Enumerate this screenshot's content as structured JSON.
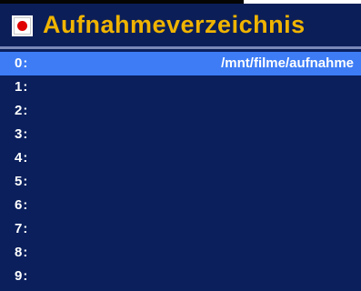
{
  "window": {
    "title": "Aufnahmeverzeichnis",
    "icon": "record-icon"
  },
  "colors": {
    "background": "#0a1f5c",
    "selected_row": "#3d7cf5",
    "title_text": "#f0b400",
    "record_dot": "#e00000"
  },
  "entries": [
    {
      "index": "0:",
      "path": "/mnt/filme/aufnahme",
      "selected": true
    },
    {
      "index": "1:",
      "path": ""
    },
    {
      "index": "2:",
      "path": ""
    },
    {
      "index": "3:",
      "path": ""
    },
    {
      "index": "4:",
      "path": ""
    },
    {
      "index": "5:",
      "path": ""
    },
    {
      "index": "6:",
      "path": ""
    },
    {
      "index": "7:",
      "path": ""
    },
    {
      "index": "8:",
      "path": ""
    },
    {
      "index": "9:",
      "path": ""
    }
  ]
}
